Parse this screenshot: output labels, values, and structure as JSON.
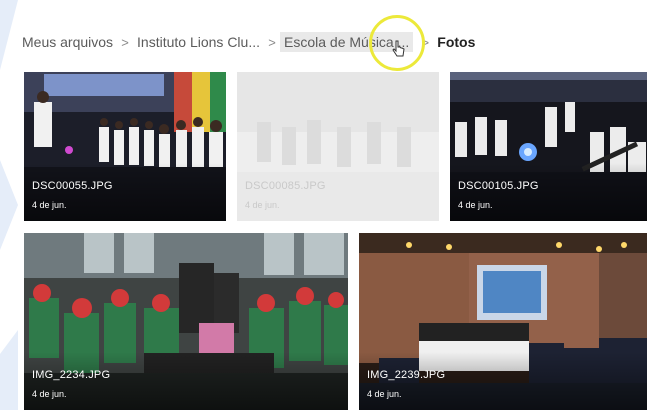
{
  "breadcrumb": {
    "items": [
      {
        "label": "Meus arquivos"
      },
      {
        "label": "Instituto Lions Clu..."
      },
      {
        "label": "Escola de Música ..."
      },
      {
        "label": "Fotos"
      }
    ],
    "separator": ">"
  },
  "photos": [
    {
      "name": "DSC00055.JPG",
      "date": "4 de jun."
    },
    {
      "name": "DSC00085.JPG",
      "date": "4 de jun."
    },
    {
      "name": "DSC00105.JPG",
      "date": "4 de jun."
    },
    {
      "name": "IMG_2234.JPG",
      "date": "4 de jun."
    },
    {
      "name": "IMG_2239.JPG",
      "date": "4 de jun."
    }
  ],
  "colors": {
    "cursor_highlight": "#ece93a",
    "breadcrumb_text": "#5b5b5b",
    "breadcrumb_current": "#222222",
    "hover_background": "#e9e9e9"
  }
}
